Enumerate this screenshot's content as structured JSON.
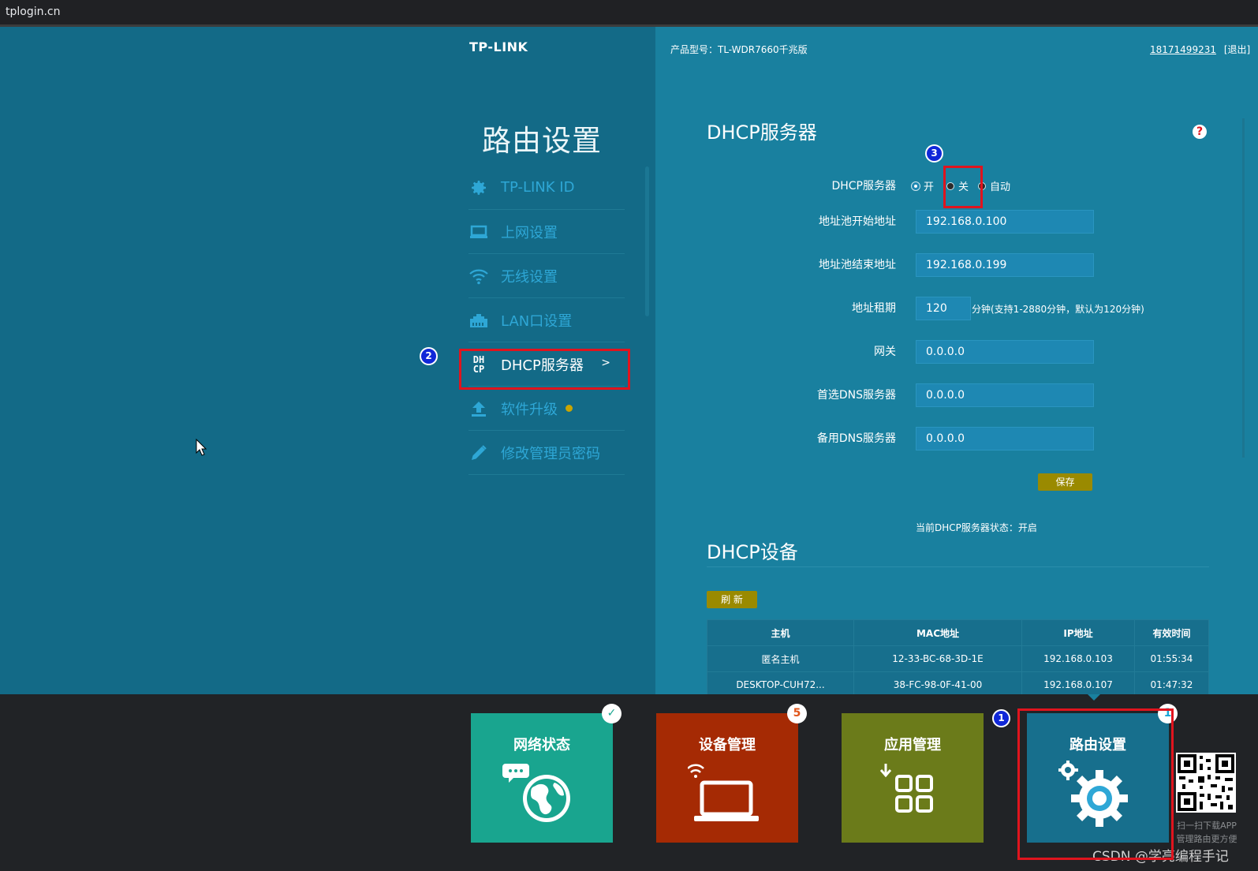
{
  "browser": {
    "url": "tplogin.cn"
  },
  "header": {
    "logo": "TP-LINK",
    "model": "产品型号：TL-WDR7660千兆版",
    "account": "18171499231",
    "logout": "[退出]"
  },
  "sidebar": {
    "title": "路由设置",
    "items": [
      {
        "label": "TP-LINK ID",
        "icon": "gear-icon"
      },
      {
        "label": "上网设置",
        "icon": "laptop-icon"
      },
      {
        "label": "无线设置",
        "icon": "wifi-icon"
      },
      {
        "label": "LAN口设置",
        "icon": "lan-port-icon"
      },
      {
        "label": "DHCP服务器",
        "icon": "dhcp-icon",
        "icon_text": [
          "DH",
          "CP"
        ],
        "arrow": ">"
      },
      {
        "label": "软件升级",
        "icon": "upload-icon"
      },
      {
        "label": "修改管理员密码",
        "icon": "pencil-icon"
      }
    ]
  },
  "dhcp_server": {
    "title": "DHCP服务器",
    "help": "?",
    "fields": {
      "server": {
        "label": "DHCP服务器",
        "options": [
          "开",
          "关",
          "自动"
        ],
        "selected": "开"
      },
      "pool_start": {
        "label": "地址池开始地址",
        "value": "192.168.0.100"
      },
      "pool_end": {
        "label": "地址池结束地址",
        "value": "192.168.0.199"
      },
      "lease": {
        "label": "地址租期",
        "value": "120",
        "note": "分钟(支持1-2880分钟，默认为120分钟)"
      },
      "gateway": {
        "label": "网关",
        "value": "0.0.0.0"
      },
      "dns_primary": {
        "label": "首选DNS服务器",
        "value": "0.0.0.0"
      },
      "dns_secondary": {
        "label": "备用DNS服务器",
        "value": "0.0.0.0"
      }
    },
    "save": "保存",
    "status": "当前DHCP服务器状态：开启"
  },
  "dhcp_devices": {
    "title": "DHCP设备",
    "refresh": "刷 新",
    "columns": [
      "主机",
      "MAC地址",
      "IP地址",
      "有效时间"
    ],
    "rows": [
      [
        "匿名主机",
        "12-33-BC-68-3D-1E",
        "192.168.0.103",
        "01:55:34"
      ],
      [
        "DESKTOP-CUH72...",
        "38-FC-98-0F-41-00",
        "192.168.0.107",
        "01:47:32"
      ]
    ]
  },
  "annotations": [
    "1",
    "2",
    "3"
  ],
  "tiles": [
    {
      "label": "网络状态",
      "color": "#19a58f",
      "badge": "✓",
      "badge_color": "#19a58f"
    },
    {
      "label": "设备管理",
      "color": "#a52a04",
      "badge": "5",
      "badge_color": "#e0561b"
    },
    {
      "label": "应用管理",
      "color": "#6b7b1a",
      "badge": ""
    },
    {
      "label": "路由设置",
      "color": "#176f8d",
      "badge": "1",
      "badge_color": "#19a5d6"
    }
  ],
  "qr": {
    "line1": "扫一扫下载APP",
    "line2": "管理路由更方便"
  },
  "watermark": "CSDN @学亮编程手记"
}
